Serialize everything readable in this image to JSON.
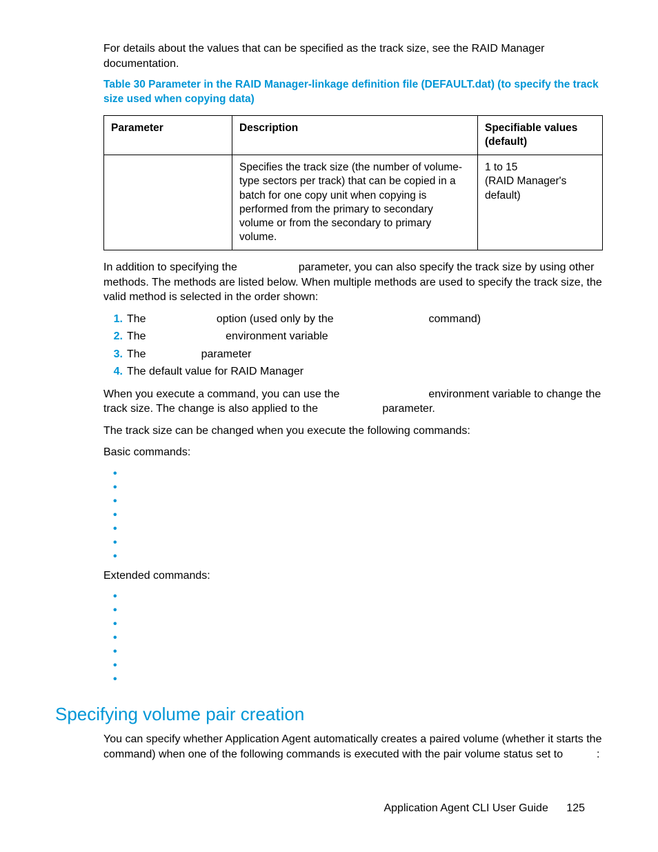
{
  "intro_para": "For details about the values that can be specified as the track size, see the RAID Manager documentation.",
  "table_title": "Table 30 Parameter in the RAID Manager-linkage definition file (DEFAULT.dat) (to specify the track size used when copying data)",
  "table": {
    "headers": {
      "param": "Parameter",
      "desc": "Description",
      "spec": "Specifiable values (default)"
    },
    "row": {
      "param": "",
      "desc": "Specifies the track size (the number of volume-type sectors per track) that can be copied in a batch for one copy unit when copying is performed from the primary to secondary volume or from the secondary to primary volume.",
      "spec": "1 to 15\n(RAID Manager's default)"
    }
  },
  "after_table_para": "In addition to specifying the                    parameter, you can also specify the track size by using other methods. The methods are listed below. When multiple methods are used to specify the track size, the valid method is selected in the order shown:",
  "numlist": [
    "The                       option (used only by the                               command)",
    "The                          environment variable",
    "The                  parameter",
    "The default value for RAID Manager"
  ],
  "exec_para": "When you execute a command, you can use the                             environment variable to change the track size. The change is also applied to the                     parameter.",
  "changed_when": "The track size can be changed when you execute the following commands:",
  "basic_label": "Basic commands:",
  "basic_items": [
    "",
    "",
    "",
    "",
    "",
    "",
    ""
  ],
  "ext_label": "Extended commands:",
  "ext_items": [
    "",
    "",
    "",
    "",
    "",
    "",
    ""
  ],
  "section_heading": "Specifying volume pair creation",
  "section_para": "You can specify whether Application Agent automatically creates a paired volume (whether it starts the                        command) when one of the following commands is executed with the pair volume status set to           :",
  "footer": {
    "title": "Application Agent CLI User Guide",
    "page": "125"
  }
}
